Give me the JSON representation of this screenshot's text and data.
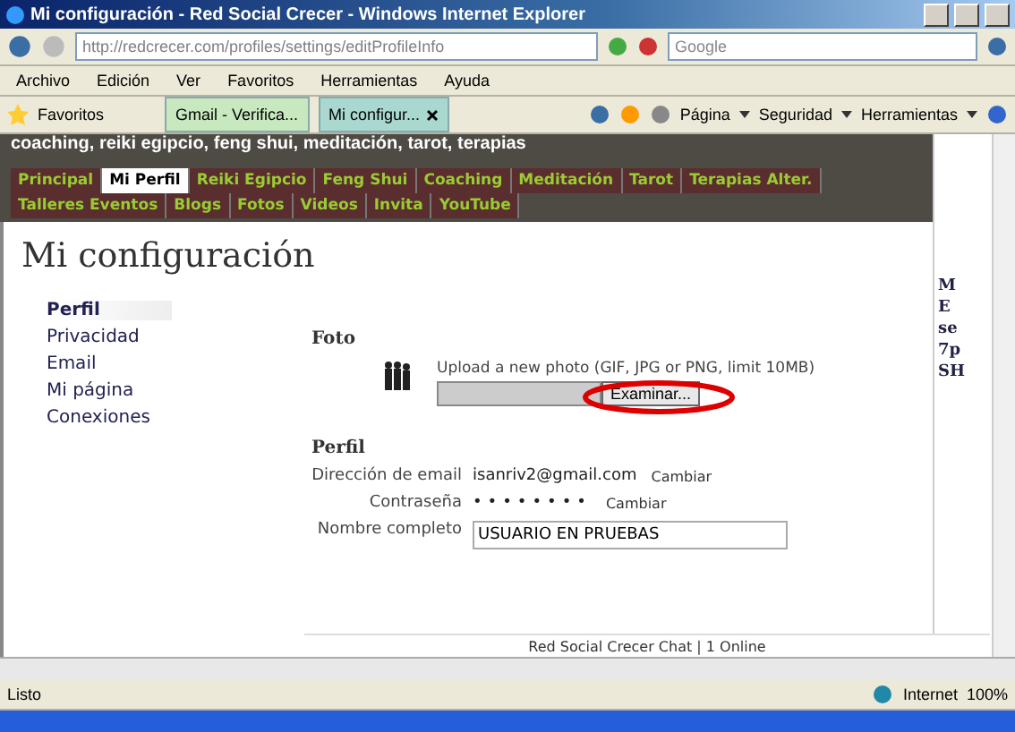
{
  "window": {
    "title": "Mi configuración - Red Social Crecer - Windows Internet Explorer"
  },
  "address": {
    "url": "http://redcrecer.com/profiles/settings/editProfileInfo",
    "search_placeholder": "Google"
  },
  "menu": [
    "Archivo",
    "Edición",
    "Ver",
    "Favoritos",
    "Herramientas",
    "Ayuda"
  ],
  "favorites": {
    "label": "Favoritos",
    "tabs": [
      {
        "label": "Gmail - Verifica...",
        "selected": false
      },
      {
        "label": "Mi configur...",
        "selected": true
      }
    ],
    "commands": [
      "Página",
      "Seguridad",
      "Herramientas"
    ]
  },
  "site": {
    "tagline": "coaching, reiki egipcio, feng shui, meditación, tarot, terapias",
    "nav": [
      {
        "label": "Principal",
        "selected": false
      },
      {
        "label": "Mi Perfil",
        "selected": true
      },
      {
        "label": "Reiki Egipcio",
        "selected": false
      },
      {
        "label": "Feng Shui",
        "selected": false
      },
      {
        "label": "Coaching",
        "selected": false
      },
      {
        "label": "Meditación",
        "selected": false
      },
      {
        "label": "Tarot",
        "selected": false
      },
      {
        "label": "Terapias Alter.",
        "selected": false
      },
      {
        "label": "Talleres Eventos",
        "selected": false
      },
      {
        "label": "Blogs",
        "selected": false
      },
      {
        "label": "Fotos",
        "selected": false
      },
      {
        "label": "Videos",
        "selected": false
      },
      {
        "label": "Invita",
        "selected": false
      },
      {
        "label": "YouTube",
        "selected": false
      }
    ]
  },
  "settings": {
    "heading": "Mi configuración",
    "sidebar": [
      {
        "label": "Perfil",
        "selected": true
      },
      {
        "label": "Privacidad",
        "selected": false
      },
      {
        "label": "Email",
        "selected": false
      },
      {
        "label": "Mi página",
        "selected": false
      },
      {
        "label": "Conexiones",
        "selected": false
      }
    ],
    "photo": {
      "heading": "Foto",
      "hint": "Upload a new photo (GIF, JPG or PNG, limit 10MB)",
      "browse": "Examinar..."
    },
    "profile": {
      "heading": "Perfil",
      "fields": [
        {
          "label": "Dirección de email",
          "kind": "text",
          "value": "isanriv2@gmail.com",
          "action": "Cambiar"
        },
        {
          "label": "Contraseña",
          "kind": "password",
          "value": "••••••••",
          "action": "Cambiar"
        },
        {
          "label": "Nombre completo",
          "kind": "input",
          "value": "USUARIO EN PRUEBAS"
        }
      ]
    }
  },
  "right_column": [
    "M",
    "E",
    "se",
    "7p",
    "SH"
  ],
  "chat": {
    "label": "Red Social Crecer Chat | 1 Online"
  },
  "status": {
    "text": "Listo",
    "zone": "Internet",
    "zoom": "100%"
  }
}
